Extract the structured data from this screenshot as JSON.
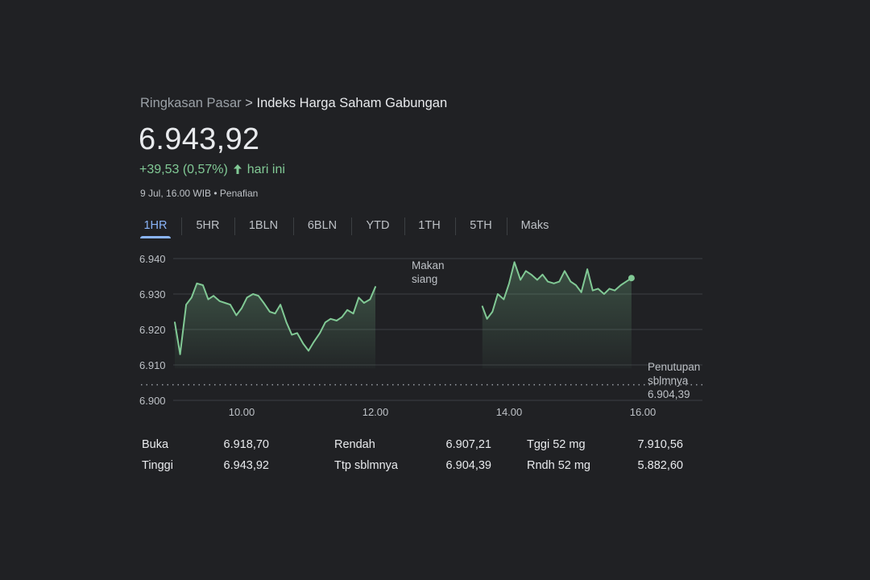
{
  "breadcrumb": {
    "parent": "Ringkasan Pasar",
    "separator": ">",
    "current": "Indeks Harga Saham Gabungan"
  },
  "price": "6.943,92",
  "change": {
    "value": "+39,53 (0,57%)",
    "suffix": "hari ini",
    "color": "#81c995"
  },
  "meta": "9 Jul, 16.00 WIB • Penafian",
  "tabs": [
    {
      "label": "1HR",
      "active": true
    },
    {
      "label": "5HR"
    },
    {
      "label": "1BLN"
    },
    {
      "label": "6BLN"
    },
    {
      "label": "YTD"
    },
    {
      "label": "1TH"
    },
    {
      "label": "5TH"
    },
    {
      "label": "Maks"
    }
  ],
  "chart_data": {
    "type": "area",
    "y_ticks": [
      "6.940",
      "6.930",
      "6.920",
      "6.910",
      "6.900"
    ],
    "y_tick_values": [
      6940,
      6930,
      6920,
      6910,
      6900
    ],
    "x_ticks": [
      "10.00",
      "12.00",
      "14.00",
      "16.00"
    ],
    "x_tick_values": [
      10,
      12,
      14,
      16
    ],
    "xlim": [
      9.0,
      17.0
    ],
    "ylim": [
      6900,
      6940
    ],
    "grid": true,
    "line_color": "#81c995",
    "series": [
      {
        "x": [
          9.0,
          9.08,
          9.17,
          9.25,
          9.33,
          9.42,
          9.5,
          9.58,
          9.67,
          9.75,
          9.83,
          9.92,
          10.0,
          10.08,
          10.17,
          10.25,
          10.33,
          10.42,
          10.5,
          10.58,
          10.67,
          10.75,
          10.83,
          10.92,
          11.0,
          11.08,
          11.17,
          11.25,
          11.33,
          11.42,
          11.5,
          11.58,
          11.67,
          11.75,
          11.83,
          11.92,
          12.0
        ],
        "y": [
          6922.0,
          6913.0,
          6927.0,
          6929.0,
          6933.0,
          6932.5,
          6928.5,
          6929.5,
          6928.0,
          6927.5,
          6927.0,
          6924.0,
          6926.0,
          6929.0,
          6930.0,
          6929.5,
          6927.5,
          6925.0,
          6924.5,
          6927.0,
          6922.0,
          6918.5,
          6919.0,
          6916.0,
          6914.0,
          6916.5,
          6919.0,
          6922.0,
          6923.0,
          6922.5,
          6923.5,
          6925.5,
          6924.5,
          6929.0,
          6927.5,
          6928.5,
          6932.0
        ]
      },
      {
        "x": [
          13.6,
          13.67,
          13.75,
          13.83,
          13.92,
          14.0,
          14.08,
          14.17,
          14.25,
          14.33,
          14.42,
          14.5,
          14.58,
          14.67,
          14.75,
          14.83,
          14.92,
          15.0,
          15.08,
          15.17,
          15.25,
          15.33,
          15.42,
          15.5,
          15.58,
          15.67,
          15.75,
          15.83
        ],
        "y": [
          6926.5,
          6923.0,
          6925.0,
          6930.0,
          6928.5,
          6933.0,
          6939.0,
          6934.0,
          6936.5,
          6935.5,
          6934.0,
          6935.5,
          6933.5,
          6933.0,
          6933.5,
          6936.5,
          6933.5,
          6932.5,
          6930.5,
          6937.0,
          6931.0,
          6931.5,
          6930.0,
          6931.5,
          6931.0,
          6932.5,
          6933.5,
          6934.5
        ]
      }
    ],
    "previous_close": 6904.39,
    "annotations": {
      "lunch_line1": "Makan",
      "lunch_line2": "siang",
      "prev_line1": "Penutupan",
      "prev_line2": "sblmnya",
      "prev_value": "6.904,39"
    }
  },
  "stats": {
    "col1": [
      {
        "label": "Buka",
        "value": "6.918,70"
      },
      {
        "label": "Tinggi",
        "value": "6.943,92"
      }
    ],
    "col2": [
      {
        "label": "Rendah",
        "value": "6.907,21"
      },
      {
        "label": "Ttp sblmnya",
        "value": "6.904,39"
      }
    ],
    "col3": [
      {
        "label": "Tggi 52 mg",
        "value": "7.910,56"
      },
      {
        "label": "Rndh 52 mg",
        "value": "5.882,60"
      }
    ]
  }
}
